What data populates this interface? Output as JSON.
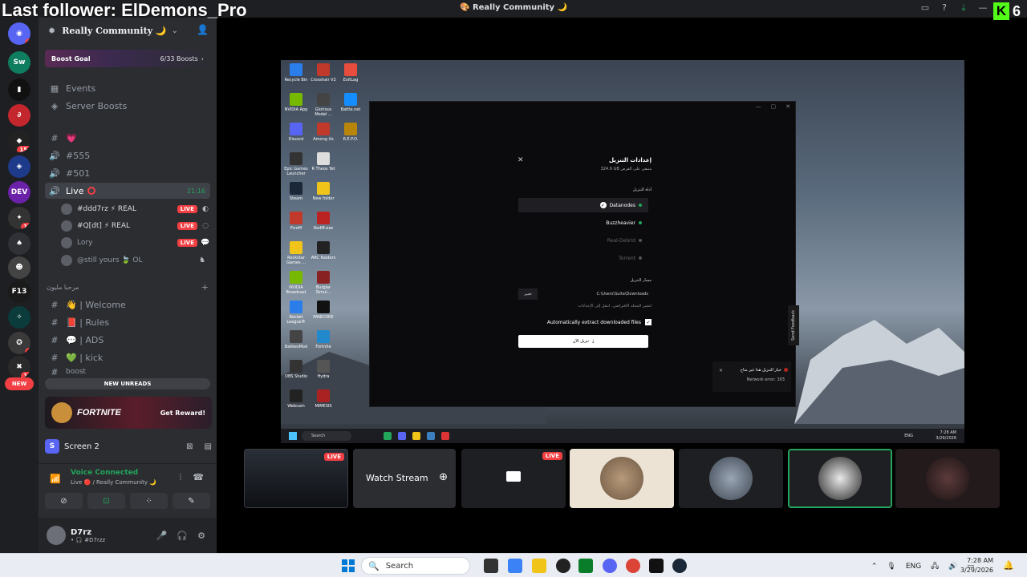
{
  "overlay": {
    "title": "Last follower: ElDemons_Pro",
    "kick_count": "6",
    "kick_letter": "K"
  },
  "window": {
    "title": "🎨 Really Community 🌙"
  },
  "rail": {
    "new_label": "NEW",
    "badges": [
      "1",
      "156",
      "15",
      "4",
      "14"
    ]
  },
  "guild": {
    "name": "Really Community 🌙",
    "boost_label": "Boost Goal",
    "boost_count": "6/33 Boosts"
  },
  "nav": {
    "events": "Events",
    "server_boosts": "Server Boosts"
  },
  "channels": {
    "heart": "💗",
    "c555": "#555",
    "c501": "#501",
    "live": "Live",
    "live_time": "21:16",
    "category": "مرحبا مليون",
    "welcome": "👋 | Welcome",
    "rules": "📕 | Rules",
    "ads": "💬 | ADS",
    "kick": "💚 | kick",
    "boost": "boost"
  },
  "voice_users": [
    {
      "name": "#ddd7rz ⚡ REAL",
      "live": "LIVE"
    },
    {
      "name": "#Q[dt] ⚡ REAL",
      "live": "LIVE"
    },
    {
      "name": "Lory",
      "live": "LIVE"
    },
    {
      "name": "@still yours 🍃 OL",
      "live": ""
    }
  ],
  "unreads": "NEW UNREADS",
  "promo": {
    "name": "FORTNITE",
    "cta": "Get Reward!"
  },
  "screen": {
    "avatar": "S",
    "name": "Screen 2"
  },
  "voice": {
    "status": "Voice Connected",
    "channel": "Live 🔴 / Really Community 🌙"
  },
  "user": {
    "name": "D7rz",
    "tag": "• 🎧 #D7rzz"
  },
  "stream": {
    "desktop_icons": [
      "Recycle Bin",
      "Crosshair V2",
      "ExitLag",
      "NVIDIA App",
      "Glorious Model ...",
      "Battle.net",
      "Discord",
      "Among Us",
      "R.E.P.O.",
      "Epic Games Launcher",
      "R Theos Yet",
      "Steam",
      "New folder",
      "FiveM",
      "RedM.exe",
      "Rockstar Games ...",
      "ARC Raiders",
      "NVIDIA Broadcast",
      "Burglar Simul...",
      "Rocket League®",
      "PANICORE",
      "BakkesMod",
      "Fortnite",
      "OBS Studio",
      "Hydra",
      "Webcam",
      "MIMESIS"
    ],
    "dialog": {
      "close": "✕",
      "title": "إعدادات التنزيل",
      "subtitle": "324.9 GB متبقي على القرص",
      "tool_label": "أداة التنزيل",
      "options": [
        "Datanodes",
        "Buzzheavier",
        "Real-Debrid",
        "Torrent"
      ],
      "path_label": "مسار التنزيل",
      "change": "تغيير",
      "path": "C:\\Users\\Sulta\\Downloads",
      "hint": "لتغيير المجلد الافتراضي، انتقل إلى الإعدادات",
      "auto_extract": "Automatically extract downloaded files",
      "download_now": "تنزيل الآن"
    },
    "feedback": "Send Feedback",
    "toast": {
      "title": "خيار التنزيل هذا غير متاح",
      "error": "Network error: 303"
    },
    "taskbar": {
      "search": "Search",
      "lang": "ENG",
      "time": "7:28 AM",
      "date": "3/29/2026"
    }
  },
  "tiles": {
    "live": "LIVE",
    "watch": "Watch Stream"
  },
  "taskbar": {
    "search": "Search",
    "lang": "ENG",
    "time": "7:28 AM",
    "date": "3/29/2026"
  }
}
